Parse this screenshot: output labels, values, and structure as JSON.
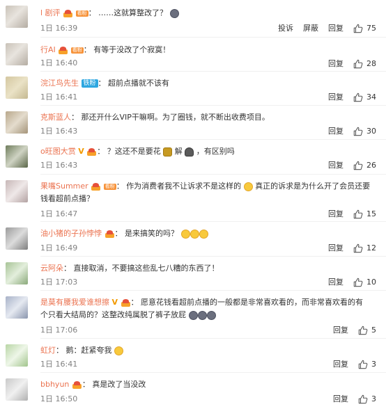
{
  "labels": {
    "report": "投诉",
    "block": "屏蔽",
    "reply": "回复"
  },
  "comments": [
    {
      "user": "l 剧评",
      "tag": "看粉",
      "text": "……这就算整改了？",
      "time": "1日 16:39",
      "likes": "75"
    },
    {
      "user": "行AI",
      "tag": "看粉",
      "text": "有等于没改了个寂寞！",
      "time": "1日 16:40",
      "likes": "28"
    },
    {
      "user": "浣江鸟先生",
      "tag": "铁粉",
      "text": "超前点播就不该有",
      "time": "1日 16:41",
      "likes": "34"
    },
    {
      "user": "克斯蓝人",
      "text": "那还开什么VIP干嘛啊。为了圈钱，就不断出收费项目。",
      "time": "1日 16:43",
      "likes": "30"
    },
    {
      "user": "o旺图大赏",
      "text_a": "？这还不是要花",
      "text_b": "解",
      "text_c": "，有区别吗",
      "time": "1日 16:43",
      "likes": "26"
    },
    {
      "user": "果嘴Summer",
      "tag": "看粉",
      "text_a": "作为消费者我不让诉求不是这样的",
      "text_b": "真正的诉求是为什么开了会员还要",
      "line2": "钱看超前点播？",
      "time": "1日 16:47",
      "likes": "15"
    },
    {
      "user": "油小猪的子孙悖悖",
      "text": "是来搞笑的吗？",
      "time": "1日 16:49",
      "likes": "12"
    },
    {
      "user": "云阿朵",
      "text": "直接取消，不要搞这些乱七八糟的东西了！",
      "time": "1日 17:03",
      "likes": "10"
    },
    {
      "user": "是莫有腰我爱谁想擦",
      "text": "愿意花钱看超前点播的一般都是非常喜欢看的，而非常喜欢看的有",
      "line2": "个只看大结局的？这整改纯属脱了裤子放屁",
      "time": "1日 17:06",
      "likes": "5"
    },
    {
      "user": "虹灯",
      "text": "鹅：赶紧夸我",
      "time": "1日 16:41",
      "likes": "3"
    },
    {
      "user": "bbhyun",
      "text": "真是改了当没改",
      "time": "1日 16:50",
      "likes": "3"
    }
  ]
}
